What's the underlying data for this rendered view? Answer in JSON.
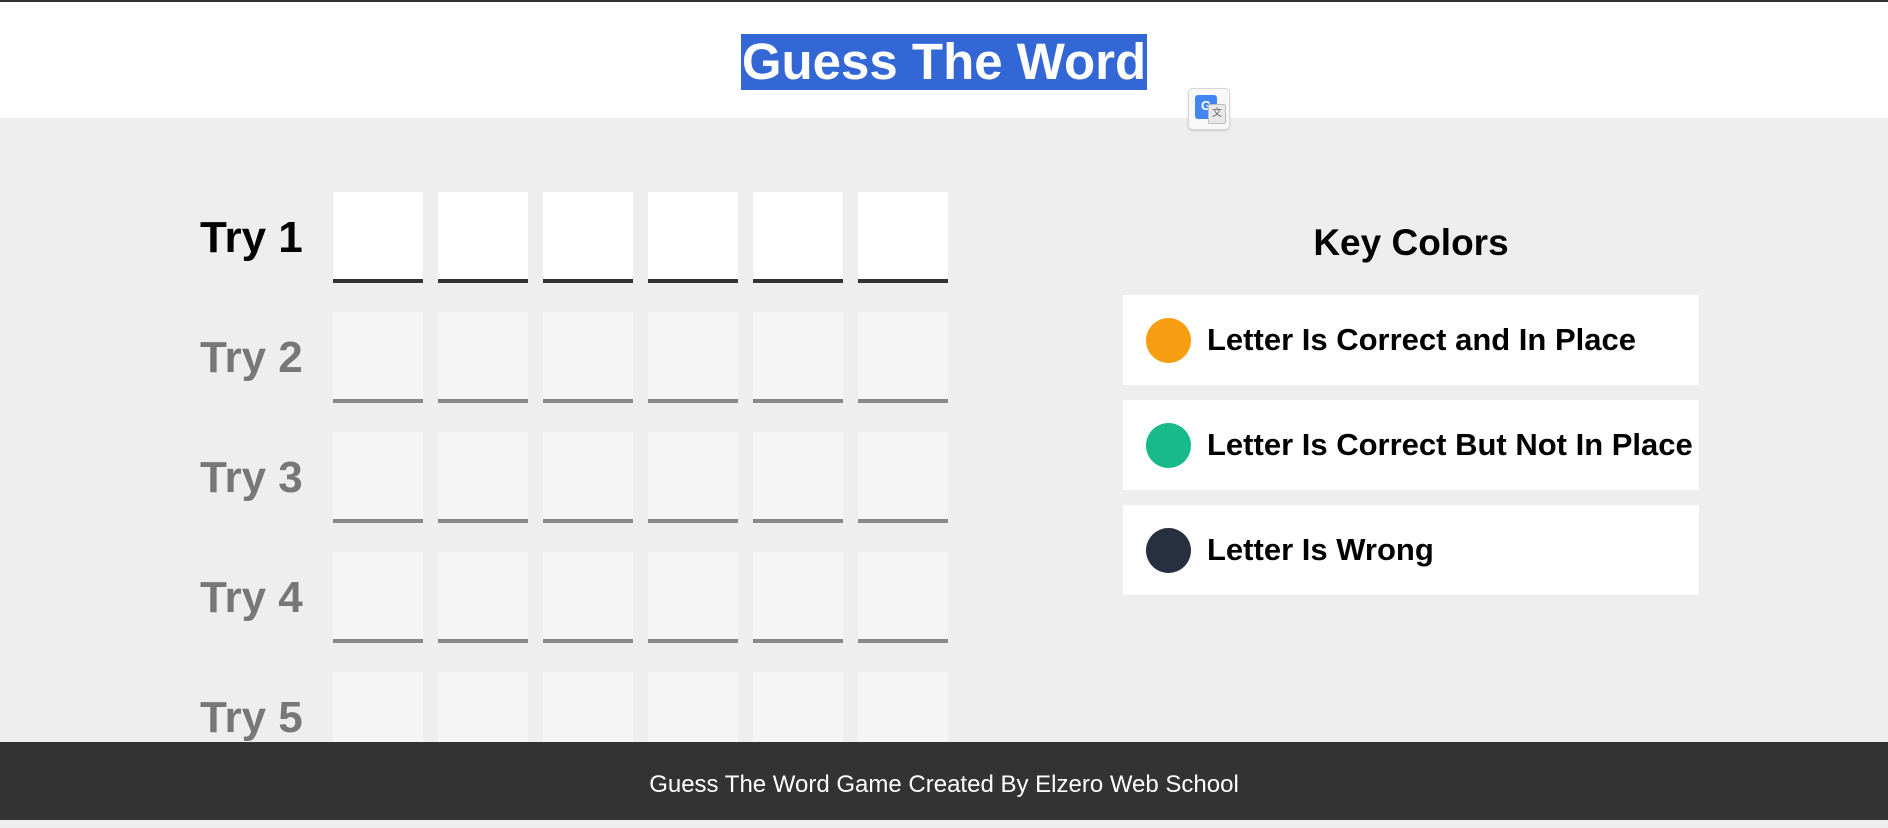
{
  "header": {
    "title": "Guess The Word"
  },
  "translate_widget": {
    "icon": "google-translate-icon",
    "glyph": "G",
    "glyph2": "文"
  },
  "tries": [
    {
      "label": "Try 1",
      "active": true,
      "letters": [
        "",
        "",
        "",
        "",
        "",
        ""
      ]
    },
    {
      "label": "Try 2",
      "active": false,
      "letters": [
        "",
        "",
        "",
        "",
        "",
        ""
      ]
    },
    {
      "label": "Try 3",
      "active": false,
      "letters": [
        "",
        "",
        "",
        "",
        "",
        ""
      ]
    },
    {
      "label": "Try 4",
      "active": false,
      "letters": [
        "",
        "",
        "",
        "",
        "",
        ""
      ]
    },
    {
      "label": "Try 5",
      "active": false,
      "letters": [
        "",
        "",
        "",
        "",
        "",
        ""
      ]
    }
  ],
  "key_colors": {
    "title": "Key Colors",
    "items": [
      {
        "label": "Letter Is Correct and In Place",
        "color": "#f89e13"
      },
      {
        "label": "Letter Is Correct But Not In Place",
        "color": "#18ba89"
      },
      {
        "label": "Letter Is Wrong",
        "color": "#27303f"
      }
    ]
  },
  "footer": {
    "text": "Guess The Word Game Created By Elzero Web School"
  }
}
